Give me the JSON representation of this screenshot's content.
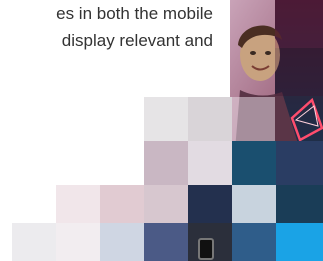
{
  "copy": {
    "line1": "es in both the mobile",
    "line2": "display relevant and"
  },
  "colors": {
    "text": "#333333",
    "accent_blue": "#1aa3e6",
    "dark_teal": "#1a3d57"
  }
}
